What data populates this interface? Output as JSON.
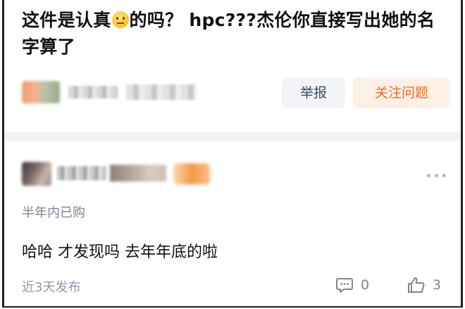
{
  "question": {
    "title_part1": "这件是认真",
    "emoji": "neutral-face-emoji",
    "title_part2": "的吗？ hpc???杰伦你直接写出她的名字算了",
    "report_label": "举报",
    "follow_label": "关注问题"
  },
  "comment": {
    "tag": "半年内已购",
    "text": "哈哈  才发现吗  去年年底的啦",
    "time": "近3天发布",
    "reply_count": "0",
    "like_count": "3"
  },
  "colors": {
    "follow_accent": "#f26b1d",
    "follow_bg": "#fdf0e6",
    "report_bg": "#f2f4f7",
    "muted_text": "#7b8696"
  }
}
